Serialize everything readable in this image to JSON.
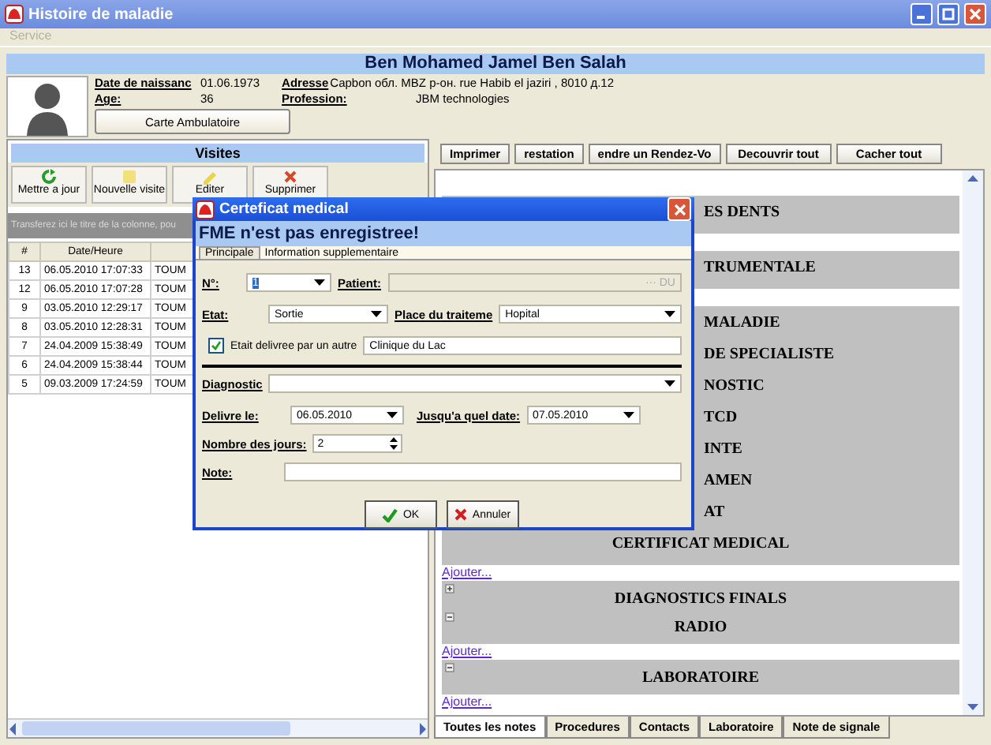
{
  "window": {
    "title": "Histoire de maladie"
  },
  "menu": [
    {
      "label": "Service",
      "disabled": true
    }
  ],
  "patient": {
    "name": "Ben Mohamed Jamel Ben Salah",
    "fields": [
      {
        "label": "Date de naissanc",
        "value": "01.06.1973"
      },
      {
        "label": "Adresse",
        "value": "Capbon обл. MBZ р-он. rue Habib el jaziri , 8010 д.12"
      },
      {
        "label": "Age:",
        "value": "36"
      },
      {
        "label": "Profession:",
        "value": "JBM technologies"
      }
    ],
    "card_button": "Carte Ambulatoire"
  },
  "visits": {
    "title": "Visites",
    "toolbar": [
      {
        "label": "Mettre a jour"
      },
      {
        "label": "Nouvelle visite"
      },
      {
        "label": "Editer"
      },
      {
        "label": "Supprimer"
      }
    ],
    "group_hint": "Transferez ici le titre de la colonne, pou",
    "columns": [
      "#",
      "Date/Heure"
    ],
    "rows": [
      {
        "number": "13",
        "date": "06.05.2010 17:07:33",
        "column_3": "TOUM"
      },
      {
        "number": "12",
        "date": "06.05.2010 17:07:28",
        "column_3": "TOUM"
      },
      {
        "number": "9",
        "date": "03.05.2010 12:29:17",
        "column_3": "TOUM"
      },
      {
        "number": "8",
        "date": "03.05.2010 12:28:31",
        "column_3": "TOUM"
      },
      {
        "number": "7",
        "date": "24.04.2009 15:38:49",
        "column_3": "TOUM"
      },
      {
        "number": "6",
        "date": "24.04.2009 15:38:44",
        "column_3": "TOUM"
      },
      {
        "number": "5",
        "date": "09.03.2009 17:24:59",
        "column_3": "TOUM"
      }
    ]
  },
  "notes": {
    "toolbar": [
      "Imprimer",
      "restation",
      "endre un Rendez-Vo",
      "Decouvrir tout",
      "Cacher tout"
    ],
    "blocks": [
      {
        "headings": [
          {
            "title": "ES DENTS",
            "kind": "covered"
          }
        ]
      },
      {
        "headings": [
          {
            "title": "TRUMENTALE",
            "kind": "covered"
          }
        ]
      },
      {
        "headings": [
          {
            "title": "MALADIE",
            "kind": "covered"
          },
          {
            "title": "DE SPECIALISTE",
            "kind": "covered"
          },
          {
            "title": "NOSTIC",
            "kind": "covered"
          },
          {
            "title": "TCD",
            "kind": "covered"
          },
          {
            "title": "INTE",
            "kind": "covered"
          },
          {
            "title": "AMEN",
            "kind": "covered"
          },
          {
            "title": "AT",
            "kind": "covered"
          },
          {
            "title": "CERTIFICAT MEDICAL",
            "kind": "full"
          }
        ],
        "add_link": "Ajouter..."
      },
      {
        "headings": [
          {
            "title": "DIAGNOSTICS FINALS",
            "kind": "expander",
            "expanded": false
          },
          {
            "title": "RADIO",
            "kind": "expander",
            "expanded": true
          }
        ],
        "add_link": "Ajouter..."
      },
      {
        "headings": [
          {
            "title": "LABORATOIRE",
            "kind": "expander",
            "expanded": true
          }
        ],
        "add_link": "Ajouter..."
      }
    ],
    "tabs": [
      {
        "label": "Toutes les notes",
        "selected": true
      },
      {
        "label": "Procedures",
        "selected": false
      },
      {
        "label": "Contacts",
        "selected": false
      },
      {
        "label": "Laboratoire",
        "selected": false
      },
      {
        "label": "Note de signale",
        "selected": false
      }
    ]
  },
  "dialog": {
    "title": "Certeficat medical",
    "banner": "FME n'est pas enregistree!",
    "tabs": [
      {
        "label": "Principale",
        "selected": true
      },
      {
        "label": "Information supplementaire",
        "selected": false
      }
    ],
    "number": {
      "label": "N°:",
      "value": "1"
    },
    "patient": {
      "label": "Patient:",
      "button": "··· DU",
      "disabled": true
    },
    "state": {
      "label": "Etat:",
      "value": "Sortie"
    },
    "place": {
      "label": "Place du traiteme",
      "value": "Hopital"
    },
    "other": {
      "label": "Etait delivree par un autre",
      "checked": true,
      "value": "Clinique du Lac"
    },
    "diagnostic": {
      "label": "Diagnostic"
    },
    "delivered": {
      "label": "Delivre le:",
      "value": "06.05.2010"
    },
    "until": {
      "label": "Jusqu'a quel date:",
      "value": "07.05.2010"
    },
    "days": {
      "label": "Nombre des jours:",
      "value": "2"
    },
    "note": {
      "label": "Note:"
    },
    "buttons": [
      {
        "label": "OK",
        "kind": "ok"
      },
      {
        "label": "Annuler",
        "kind": "cancel"
      }
    ]
  }
}
